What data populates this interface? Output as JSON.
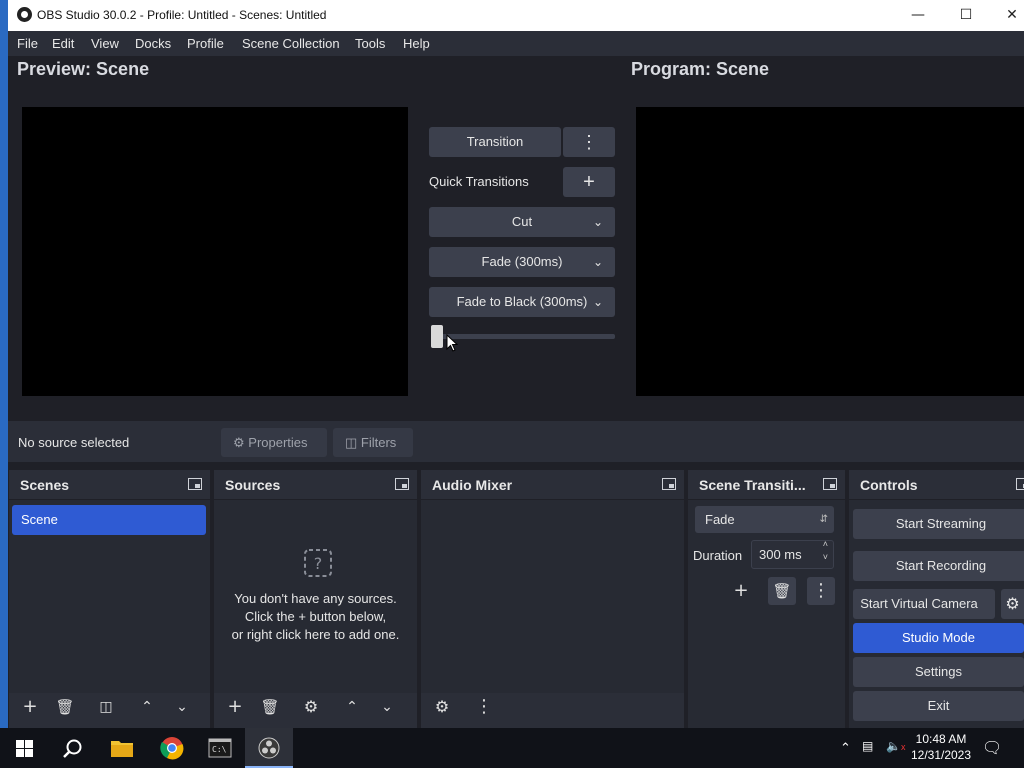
{
  "window": {
    "title": "OBS Studio 30.0.2 - Profile: Untitled - Scenes: Untitled"
  },
  "menu": [
    "File",
    "Edit",
    "View",
    "Docks",
    "Profile",
    "Scene Collection",
    "Tools",
    "Help"
  ],
  "preview": {
    "label": "Preview: Scene"
  },
  "program": {
    "label": "Program: Scene"
  },
  "transition_panel": {
    "transition_button": "Transition",
    "quick_transitions_label": "Quick Transitions",
    "dropdowns": [
      "Cut",
      "Fade (300ms)",
      "Fade to Black (300ms)"
    ],
    "slider_value": 0
  },
  "source_bar": {
    "status": "No source selected",
    "properties": "Properties",
    "filters": "Filters"
  },
  "docks": {
    "scenes": {
      "title": "Scenes",
      "items": [
        "Scene"
      ]
    },
    "sources": {
      "title": "Sources",
      "empty_lines": [
        "You don't have any sources.",
        "Click the + button below,",
        "or right click here to add one."
      ]
    },
    "audio_mixer": {
      "title": "Audio Mixer"
    },
    "scene_transitions": {
      "title": "Scene Transiti...",
      "selected": "Fade",
      "duration_label": "Duration",
      "duration_value": "300 ms"
    },
    "controls": {
      "title": "Controls",
      "start_streaming": "Start Streaming",
      "start_recording": "Start Recording",
      "start_virtual_camera": "Start Virtual Camera",
      "studio_mode": "Studio Mode",
      "settings": "Settings",
      "exit": "Exit"
    }
  },
  "taskbar": {
    "time": "10:48 AM",
    "date": "12/31/2023"
  },
  "colors": {
    "accent": "#2f5bd3",
    "background": "#1f2027",
    "panel": "#2b2e38",
    "button": "#3c404d"
  }
}
